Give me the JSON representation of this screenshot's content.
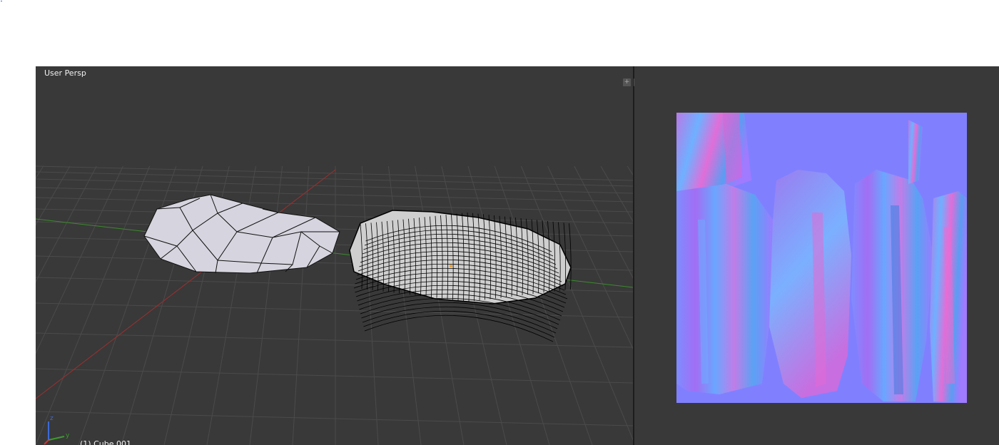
{
  "viewport": {
    "view_label": "User Persp",
    "object_label": "(1) Cube.001",
    "background": "#393939",
    "grid_color": "#4b4b4b",
    "x_axis_color": "#9e2f2f",
    "y_axis_color": "#3c8a2d"
  },
  "axis_gizmo": {
    "z_label": "z",
    "y_label": "y"
  },
  "split_handles": {
    "left": "+",
    "right": "+"
  },
  "image_editor": {
    "background": "#393939",
    "texture_base_color": "#8080ff"
  }
}
